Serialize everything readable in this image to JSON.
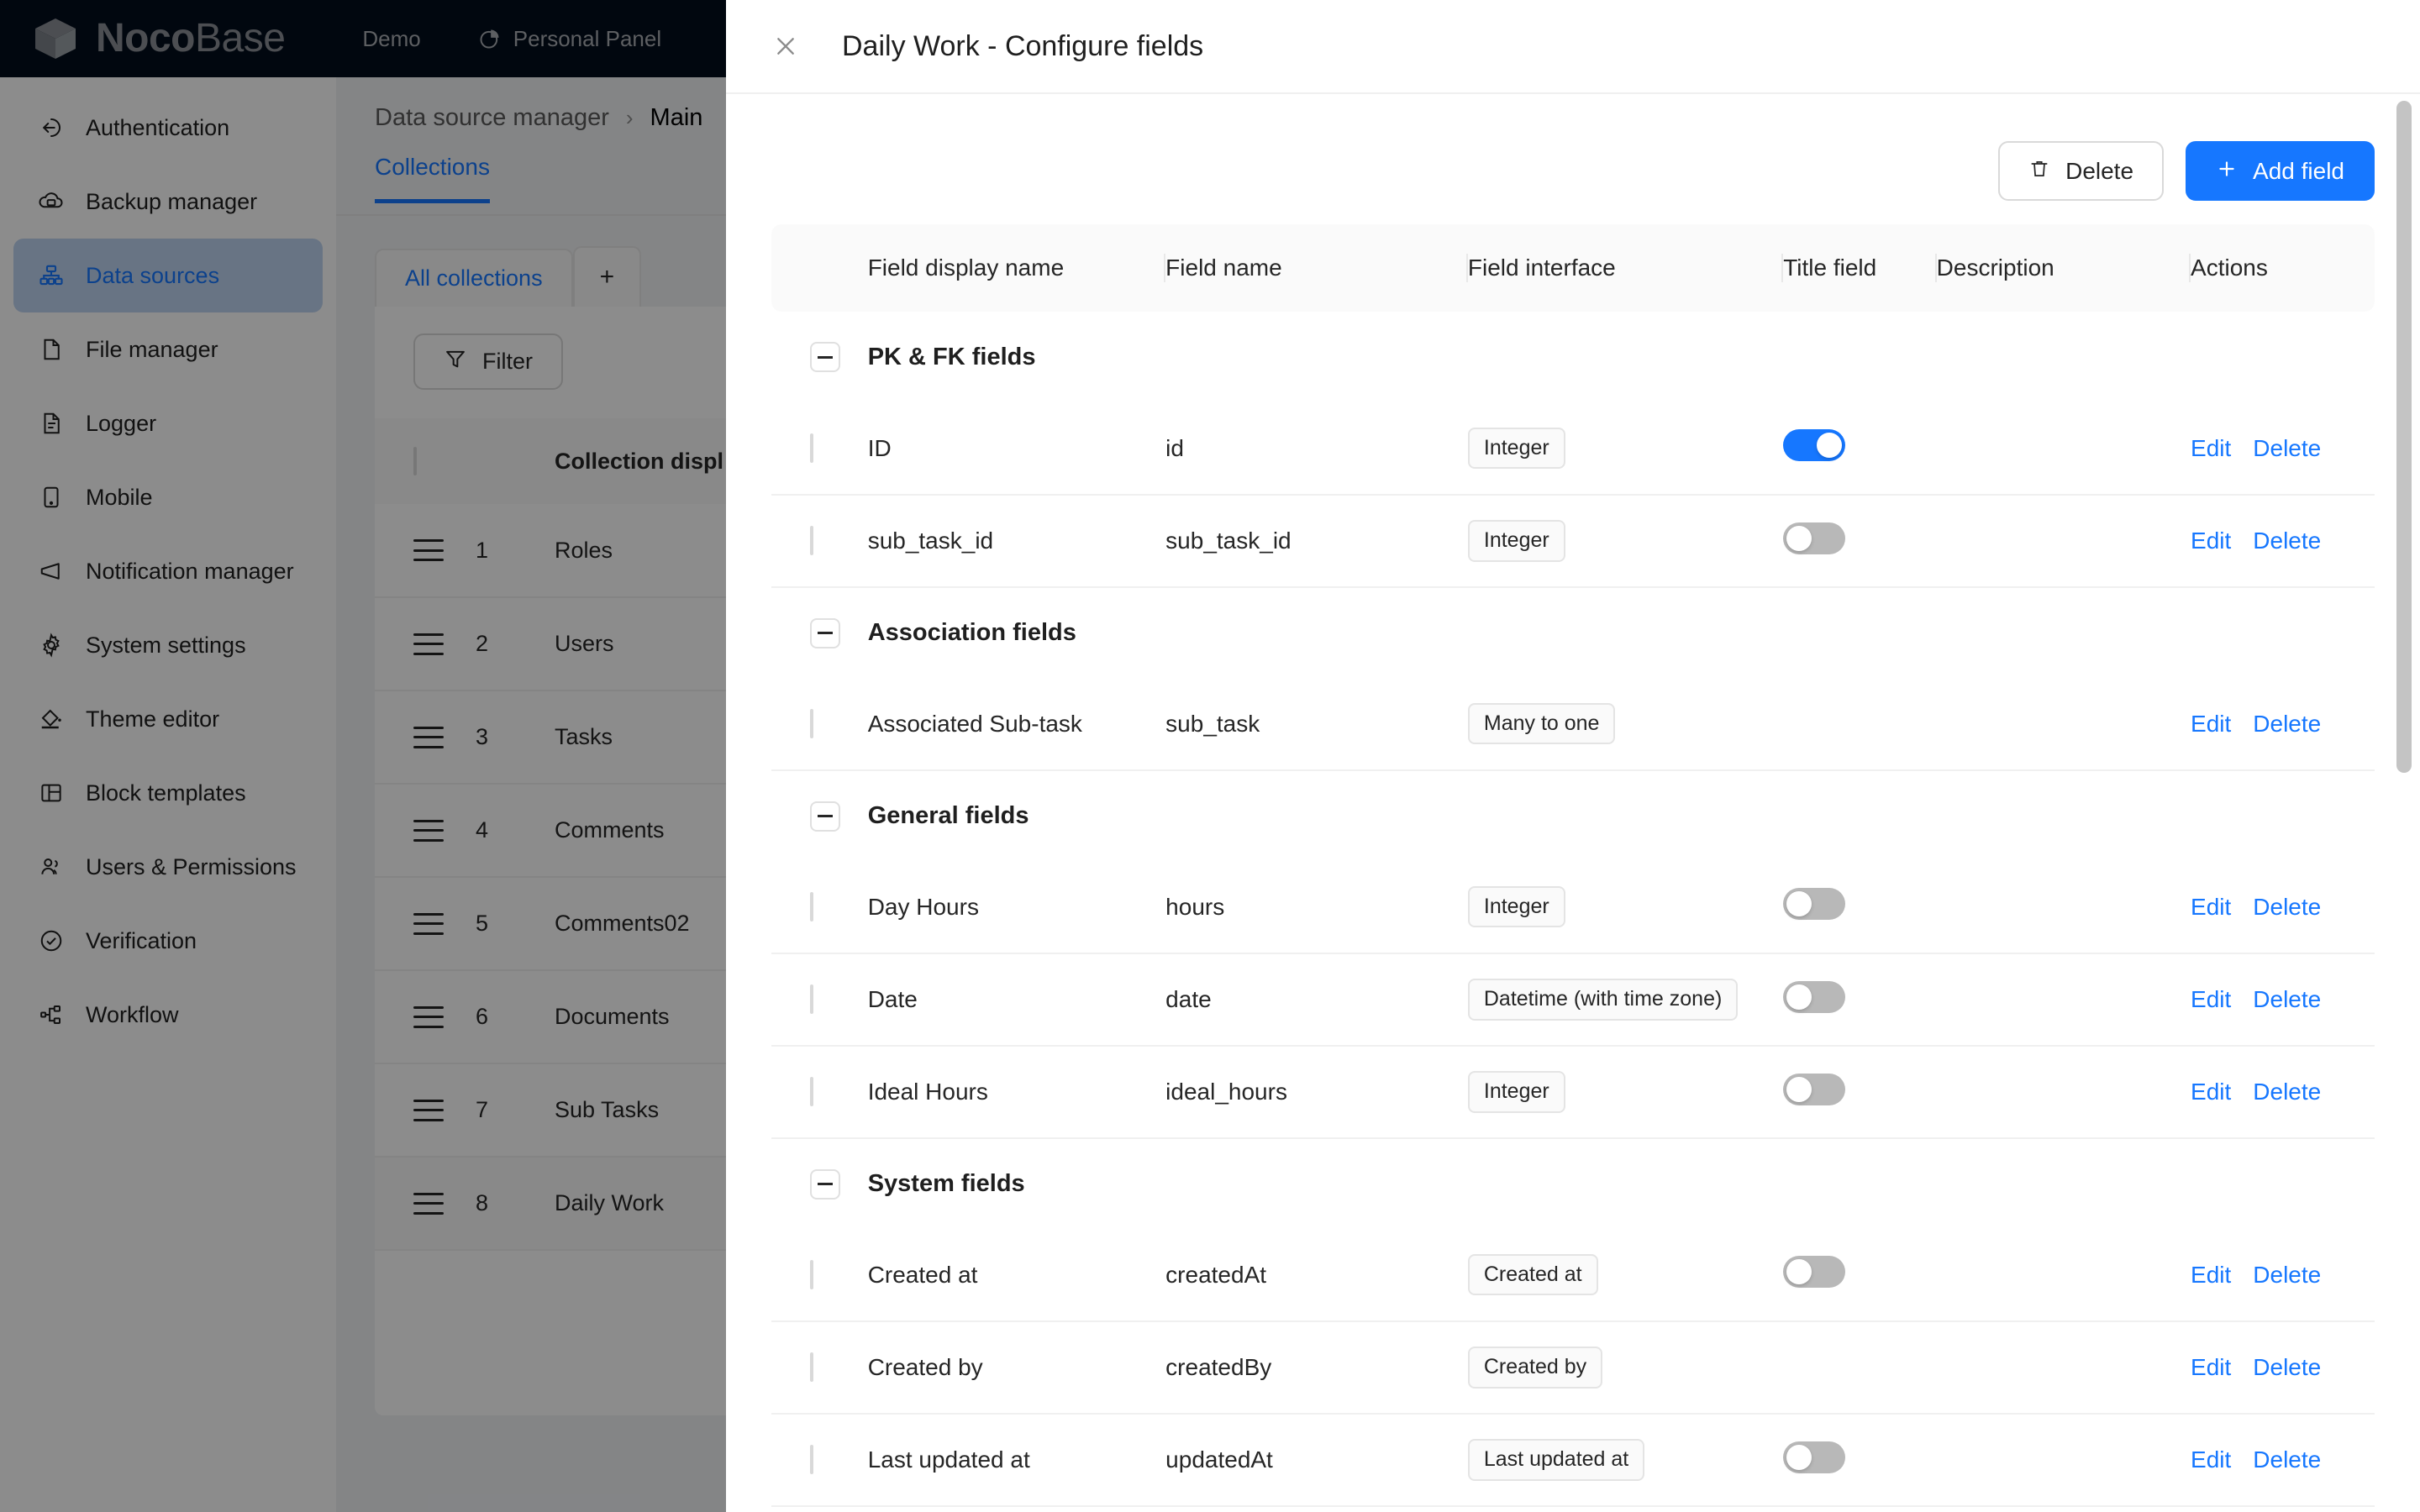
{
  "topbar": {
    "brand_primary": "Noco",
    "brand_secondary": "Base",
    "nav": [
      {
        "label": "Demo",
        "icon": "none"
      },
      {
        "label": "Personal Panel",
        "icon": "pie-chart-icon"
      }
    ]
  },
  "sidebar": {
    "items": [
      {
        "label": "Authentication",
        "icon": "login-icon",
        "active": false
      },
      {
        "label": "Backup manager",
        "icon": "cloud-backup-icon",
        "active": false
      },
      {
        "label": "Data sources",
        "icon": "sitemap-icon",
        "active": true
      },
      {
        "label": "File manager",
        "icon": "file-icon",
        "active": false
      },
      {
        "label": "Logger",
        "icon": "file-lines-icon",
        "active": false
      },
      {
        "label": "Mobile",
        "icon": "mobile-icon",
        "active": false
      },
      {
        "label": "Notification manager",
        "icon": "megaphone-icon",
        "active": false
      },
      {
        "label": "System settings",
        "icon": "gear-icon",
        "active": false
      },
      {
        "label": "Theme editor",
        "icon": "paint-bucket-icon",
        "active": false
      },
      {
        "label": "Block templates",
        "icon": "layout-icon",
        "active": false
      },
      {
        "label": "Users & Permissions",
        "icon": "users-icon",
        "active": false
      },
      {
        "label": "Verification",
        "icon": "check-circle-icon",
        "active": false
      },
      {
        "label": "Workflow",
        "icon": "workflow-icon",
        "active": false
      }
    ]
  },
  "background": {
    "breadcrumb": {
      "parent": "Data source manager",
      "separator": "›",
      "current": "Main"
    },
    "tab_collections": "Collections",
    "sub_tabs": [
      {
        "label": "All collections"
      },
      {
        "label": "+"
      }
    ],
    "filter_label": "Filter",
    "table_header": "Collection displ",
    "rows": [
      {
        "index": "1",
        "name": "Roles"
      },
      {
        "index": "2",
        "name": "Users"
      },
      {
        "index": "3",
        "name": "Tasks"
      },
      {
        "index": "4",
        "name": "Comments"
      },
      {
        "index": "5",
        "name": "Comments02"
      },
      {
        "index": "6",
        "name": "Documents"
      },
      {
        "index": "7",
        "name": "Sub Tasks"
      },
      {
        "index": "8",
        "name": "Daily Work"
      }
    ]
  },
  "drawer": {
    "title": "Daily Work - Configure fields",
    "close_icon": "close-icon",
    "buttons": {
      "delete_label": "Delete",
      "delete_icon": "trash-icon",
      "add_field_label": "Add field",
      "add_field_icon": "plus-icon"
    },
    "columns": [
      "Field display name",
      "Field name",
      "Field interface",
      "Title field",
      "Description",
      "Actions"
    ],
    "groups": [
      {
        "label": "PK & FK fields",
        "rows": [
          {
            "display": "ID",
            "name": "id",
            "interface": "Integer",
            "title_field": true,
            "has_toggle": true,
            "description": "",
            "edit": "Edit",
            "delete": "Delete"
          },
          {
            "display": "sub_task_id",
            "name": "sub_task_id",
            "interface": "Integer",
            "title_field": false,
            "has_toggle": true,
            "description": "",
            "edit": "Edit",
            "delete": "Delete"
          }
        ]
      },
      {
        "label": "Association fields",
        "rows": [
          {
            "display": "Associated Sub-task",
            "name": "sub_task",
            "interface": "Many to one",
            "title_field": false,
            "has_toggle": false,
            "description": "",
            "edit": "Edit",
            "delete": "Delete"
          }
        ]
      },
      {
        "label": "General fields",
        "rows": [
          {
            "display": "Day Hours",
            "name": "hours",
            "interface": "Integer",
            "title_field": false,
            "has_toggle": true,
            "description": "",
            "edit": "Edit",
            "delete": "Delete"
          },
          {
            "display": "Date",
            "name": "date",
            "interface": "Datetime (with time zone)",
            "title_field": false,
            "has_toggle": true,
            "description": "",
            "edit": "Edit",
            "delete": "Delete"
          },
          {
            "display": "Ideal Hours",
            "name": "ideal_hours",
            "interface": "Integer",
            "title_field": false,
            "has_toggle": true,
            "description": "",
            "edit": "Edit",
            "delete": "Delete"
          }
        ]
      },
      {
        "label": "System fields",
        "rows": [
          {
            "display": "Created at",
            "name": "createdAt",
            "interface": "Created at",
            "title_field": false,
            "has_toggle": true,
            "description": "",
            "edit": "Edit",
            "delete": "Delete"
          },
          {
            "display": "Created by",
            "name": "createdBy",
            "interface": "Created by",
            "title_field": false,
            "has_toggle": false,
            "description": "",
            "edit": "Edit",
            "delete": "Delete"
          },
          {
            "display": "Last updated at",
            "name": "updatedAt",
            "interface": "Last updated at",
            "title_field": false,
            "has_toggle": true,
            "description": "",
            "edit": "Edit",
            "delete": "Delete"
          }
        ]
      }
    ]
  },
  "colors": {
    "accent": "#1677ff",
    "topbar_bg": "#030d1c",
    "page_bg": "#f0f2f5",
    "active_nav_bg": "#bdd4f0"
  }
}
